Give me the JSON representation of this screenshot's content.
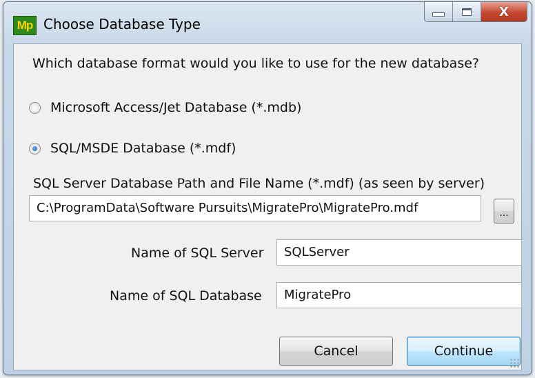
{
  "window": {
    "title": "Choose Database Type",
    "icon_text": "Mp",
    "minimize_icon": "minimize-icon",
    "maximize_icon": "maximize-icon",
    "close_glyph": "X"
  },
  "prompt": "Which database format would you like to use for the new database?",
  "options": [
    {
      "label": "Microsoft Access/Jet Database (*.mdb)",
      "selected": false
    },
    {
      "label": "SQL/MSDE Database (*.mdf)",
      "selected": true
    }
  ],
  "path": {
    "label": "SQL Server Database Path and File Name (*.mdf) (as seen by server)",
    "value": "C:\\ProgramData\\Software Pursuits\\MigratePro\\MigratePro.mdf",
    "browse_label": "..."
  },
  "server": {
    "label": "Name of SQL Server",
    "value": "SQLServer"
  },
  "database": {
    "label": "Name of SQL Database",
    "value": "MigratePro"
  },
  "buttons": {
    "cancel": "Cancel",
    "continue": "Continue"
  },
  "colors": {
    "accent": "#3c7fb1",
    "close": "#c4472f",
    "icon_bg": "#2f8a1e"
  }
}
